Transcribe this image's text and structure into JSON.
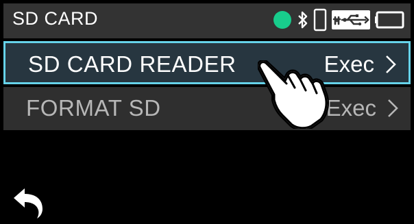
{
  "header": {
    "title": "SD CARD",
    "status_icons": [
      "recording-status-dot",
      "bluetooth-icon",
      "phone-icon",
      "usb-icon",
      "battery-icon"
    ],
    "status_dot_color": "#18cc8c"
  },
  "menu": {
    "items": [
      {
        "label": "SD CARD READER",
        "action": "Exec",
        "selected": true
      },
      {
        "label": "FORMAT SD",
        "action": "Exec",
        "selected": false
      }
    ]
  },
  "footer": {
    "back_icon": "back-arrow-icon"
  },
  "overlay": {
    "icon": "tapping-hand-icon"
  },
  "colors": {
    "background": "#000000",
    "titlebar": "#333333",
    "selected_border": "#66d3ea",
    "selected_fill": "#273640"
  }
}
